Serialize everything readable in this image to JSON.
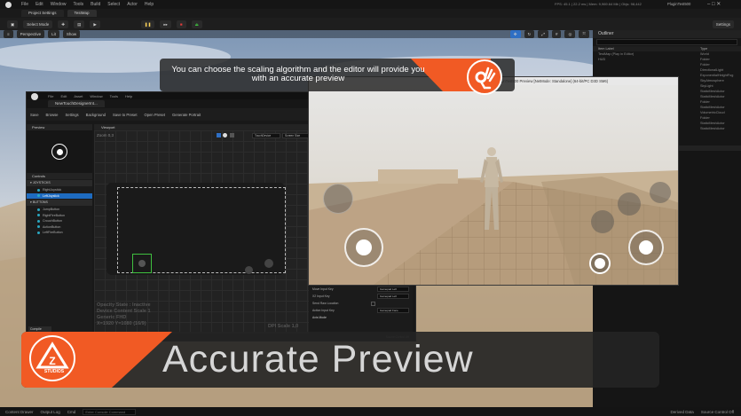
{
  "editor": {
    "menu": [
      "File",
      "Edit",
      "Window",
      "Tools",
      "Build",
      "Select",
      "Actor",
      "Help"
    ],
    "tabs": [
      "Project Settings",
      "TestMap"
    ],
    "toolbar": [
      "Select Mode",
      "Settings"
    ],
    "viewport_controls": [
      "Perspective",
      "Lit",
      "Show"
    ],
    "stats": "FPS: 45.1 | 22.2 ms | Mem: 9,969.64 Mb | Objs: 98,442",
    "project_name": "PluginTest500",
    "status_bar": [
      "Content Drawer",
      "Output Log",
      "Cmd",
      "Enter Console Command",
      "Derived Data",
      "Source Control Off"
    ]
  },
  "outliner": {
    "title": "Outliner",
    "columns": [
      "Item Label",
      "Type"
    ],
    "items": [
      {
        "label": "TestMap (Play in Editor)",
        "type": "World"
      },
      {
        "label": "HUD",
        "type": "Folder"
      },
      {
        "label": "",
        "type": "Folder"
      },
      {
        "label": "",
        "type": "DirectionalLight"
      },
      {
        "label": "",
        "type": "ExponentialHeightFog"
      },
      {
        "label": "",
        "type": "SkyAtmosphere"
      },
      {
        "label": "",
        "type": "SkyLight"
      },
      {
        "label": "",
        "type": "StaticMeshActor"
      },
      {
        "label": "",
        "type": "StaticMeshActor"
      },
      {
        "label": "",
        "type": "Folder"
      },
      {
        "label": "",
        "type": "StaticMeshActor"
      },
      {
        "label": "",
        "type": "VolumetricCloud"
      },
      {
        "label": "",
        "type": "Folder"
      },
      {
        "label": "",
        "type": "StaticMeshActor"
      },
      {
        "label": "",
        "type": "StaticMeshActor"
      }
    ],
    "settings_label": "Settings"
  },
  "banner": {
    "text": "You can choose the scaling algorithm and the editor will provide you with an accurate preview"
  },
  "designer": {
    "menu": [
      "File",
      "Edit",
      "Asset",
      "Window",
      "Tools",
      "Help"
    ],
    "tab": "NewTouchDesignerInt...",
    "toolbar": [
      "Save",
      "Browse",
      "Settings",
      "Background",
      "Save to Preset",
      "Open Preset",
      "Generate Portrait"
    ],
    "preview_title": "Preview",
    "viewport_title": "Viewport",
    "zoom": "Zoom 0,3",
    "viewport_selects": [
      "TouchDevice",
      "Screen Size"
    ],
    "controls_title": "Controls",
    "joysticks_header": "JOYSTICKS",
    "joysticks": [
      "RightJoystick",
      "LeftJoystick"
    ],
    "buttons_header": "BUTTONS",
    "buttons": [
      "JumpButton",
      "RightFireButton",
      "CrouchButton",
      "ActionButton",
      "LeftFireButton"
    ],
    "canvas_info": [
      "Opacity State : Inactive",
      "Device Content Scale 1",
      "Generic FHD",
      "X=1920 Y=1080 (16/9)"
    ],
    "dpi_scale": "DPI Scale 1,0",
    "compile": "Compile"
  },
  "details": {
    "rows": [
      {
        "label": "Move Input Key",
        "value": "Gamepad Left"
      },
      {
        "label": "X2 Input Key",
        "value": "Gamepad Left"
      },
      {
        "label": "Send Raw Location",
        "value": ""
      },
      {
        "label": "Action Input Key",
        "value": "Gamepad Face"
      }
    ],
    "section": "Axis Mode",
    "source_control": "Source Control Off"
  },
  "game": {
    "title": "PluginTest500 Preview [NetMode: Standalone] (64-bit/PC D3D SM6)"
  },
  "brand": {
    "name": "STUDIOS",
    "logo_mark": "Z"
  },
  "title": "Accurate Preview",
  "colors": {
    "accent_orange": "#f15a24",
    "selection_blue": "#1e6bc0",
    "play_green": "#3fbf3f",
    "stop_red": "#e03b3b"
  }
}
